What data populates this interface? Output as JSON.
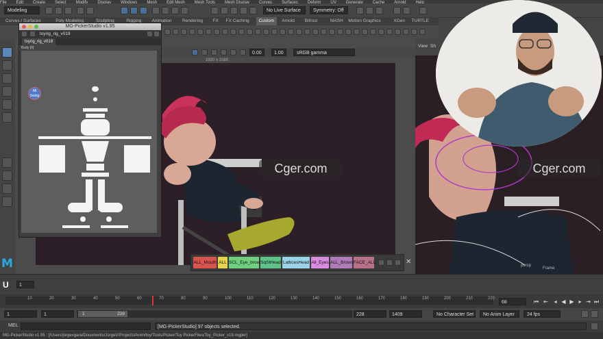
{
  "menubar": {
    "items": [
      "File",
      "Edit",
      "Create",
      "Select",
      "Modify",
      "Display",
      "Windows",
      "Mesh",
      "Edit Mesh",
      "Mesh Tools",
      "Mesh Display",
      "Curves",
      "Surfaces",
      "Deform",
      "UV",
      "Generate",
      "Cache",
      "Arnold",
      "Help"
    ]
  },
  "status_line": {
    "mode": "Modeling",
    "live_surface": "No Live Surface",
    "symmetry": "Symmetry: Off"
  },
  "shelf_tabs": [
    "Curves / Surfaces",
    "Poly Modeling",
    "Sculpting",
    "Rigging",
    "Animation",
    "Rendering",
    "FX",
    "FX Caching",
    "Custom",
    "Arnold",
    "Bifrost",
    "MASH",
    "Motion Graphics",
    "XGen",
    "TURTLE"
  ],
  "shelf_active": "Custom",
  "viewport": {
    "toolbar": {
      "value1": "0.00",
      "value2": "1.00",
      "colorspace": "sRGB gamma"
    },
    "resolution": "1920 x 1080",
    "watermark": "Cger.com"
  },
  "picker": {
    "title": "MG-PickerStudio v1.95",
    "file": "toyrig_rig_v019",
    "tab": "toyrig_rig_v019",
    "panel": "Body [0]",
    "all_button": "All",
    "all_sub": "Swing"
  },
  "right_viewport": {
    "menu": [
      "View",
      "Sh"
    ],
    "watermark": "Cger.com",
    "camera_label": "persp",
    "frame_label": "Frame"
  },
  "selection_sets": {
    "buttons": [
      {
        "label": "ALL_Mouth",
        "color": "#d9534f"
      },
      {
        "label": "ALL",
        "color": "#e8d44d"
      },
      {
        "label": "SCL_Eye_brow",
        "color": "#6fcf7f"
      },
      {
        "label": "SqStHead",
        "color": "#5ec28a"
      },
      {
        "label": "LatticesHead",
        "color": "#9ad3e8"
      },
      {
        "label": "All_Eyes",
        "color": "#d98be0"
      },
      {
        "label": "ALL_Brows",
        "color": "#b07ab8"
      },
      {
        "label": "FACE_ALL",
        "color": "#b9708a"
      }
    ]
  },
  "timeline": {
    "current_frame": "1",
    "ticks": [
      "10",
      "20",
      "30",
      "40",
      "50",
      "60",
      "70",
      "80",
      "90",
      "100",
      "110",
      "120",
      "130",
      "140",
      "150",
      "160",
      "170",
      "180",
      "190",
      "200",
      "210",
      "220"
    ],
    "playhead_frame": "68",
    "marker_frame": "68"
  },
  "range": {
    "start": "1",
    "start2": "1",
    "slider_left": "1",
    "slider_right": "228",
    "end": "228",
    "end2": "1409",
    "character_set": "No Character Set",
    "anim_layer": "No Anim Layer",
    "fps": "24 fps"
  },
  "command_line": {
    "label": "MEL",
    "result": "[MG-PickerStudio] 97 objects selected."
  },
  "help_line": "MG-PickerStudio v1.95 : [/Users/jorgevgara/Documents/JorgeV/Projects/Anim/toy/Tools/Picker/Toy PickerFiles/Toy_Picker_v19.mgpkr]"
}
